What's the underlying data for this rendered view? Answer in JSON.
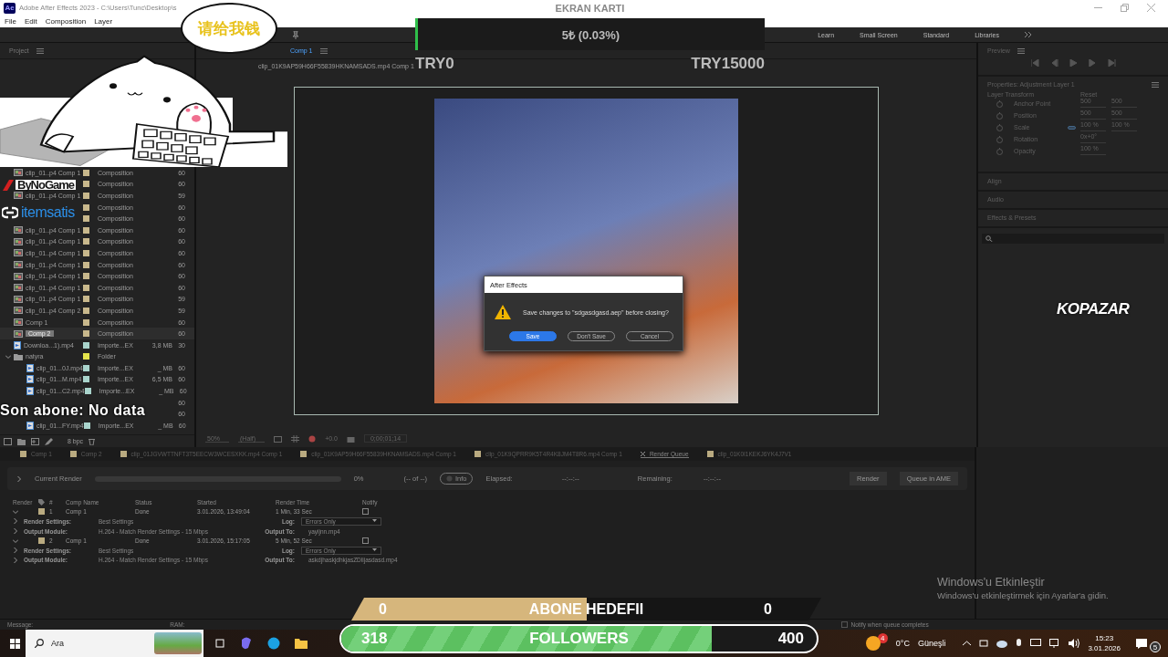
{
  "window": {
    "app_icon": "Ae",
    "title": "Adobe After Effects 2023 - C:\\Users\\Tunc\\Desktop\\s"
  },
  "menu": [
    "File",
    "Edit",
    "Composition",
    "Layer"
  ],
  "workspaces": [
    {
      "label": "Learn",
      "selected": false
    },
    {
      "label": "Small Screen",
      "selected": false
    },
    {
      "label": "Standard",
      "selected": false
    },
    {
      "label": "Libraries",
      "selected": false
    }
  ],
  "project": {
    "tab": "Project",
    "bit_depth": "8 bpc",
    "items": [
      {
        "kind": "comp",
        "name": "clip_01..p4 Comp 1",
        "type": "Composition",
        "fps": "60",
        "color": "#c8b88c",
        "selected": false
      },
      {
        "type": "Composition",
        "fps": "60",
        "color": "#c8b88c"
      },
      {
        "kind": "comp",
        "name": "clip_01..p4 Comp 1",
        "type": "Composition",
        "fps": "59",
        "color": "#c8b88c",
        "selected": false
      },
      {
        "type": "Composition",
        "fps": "60",
        "color": "#c8b88c"
      },
      {
        "type": "Composition",
        "fps": "60",
        "color": "#c8b88c"
      },
      {
        "kind": "comp",
        "name": "clip_01..p4 Comp 1",
        "type": "Composition",
        "fps": "60",
        "color": "#c8b88c",
        "selected": false
      },
      {
        "kind": "comp",
        "name": "clip_01..p4 Comp 1",
        "type": "Composition",
        "fps": "60",
        "color": "#c8b88c",
        "selected": false
      },
      {
        "kind": "comp",
        "name": "clip_01..p4 Comp 1",
        "type": "Composition",
        "fps": "60",
        "color": "#c8b88c",
        "selected": false
      },
      {
        "kind": "comp",
        "name": "clip_01..p4 Comp 1",
        "type": "Composition",
        "fps": "60",
        "color": "#c8b88c",
        "selected": false
      },
      {
        "kind": "comp",
        "name": "clip_01..p4 Comp 1",
        "type": "Composition",
        "fps": "60",
        "color": "#c8b88c",
        "selected": false
      },
      {
        "kind": "comp",
        "name": "clip_01..p4 Comp 1",
        "type": "Composition",
        "fps": "60",
        "color": "#c8b88c",
        "selected": false
      },
      {
        "kind": "comp",
        "name": "clip_01..p4 Comp 1",
        "type": "Composition",
        "fps": "59",
        "color": "#c8b88c",
        "selected": false
      },
      {
        "kind": "comp",
        "name": "clip_01..p4 Comp 2",
        "type": "Composition",
        "fps": "59",
        "color": "#c8b88c",
        "selected": false
      },
      {
        "kind": "comp",
        "name": "Comp 1",
        "type": "Composition",
        "fps": "60",
        "color": "#c8b88c",
        "selected": false
      },
      {
        "kind": "comp",
        "name": "Comp 2",
        "type": "Composition",
        "fps": "60",
        "color": "#c8b88c",
        "selected": true
      },
      {
        "kind": "footage",
        "name": "Downloa...1).mp4",
        "type": "Importe...EX",
        "size": "3,8 MB",
        "fps": "30",
        "color": "#a9d4cc",
        "selected": false
      },
      {
        "kind": "folder",
        "name": "natyra",
        "type": "Folder",
        "color": "#e4e44c",
        "selected": false,
        "expanded": true,
        "children": [
          {
            "kind": "footage",
            "name": "clip_01...0J.mp4",
            "type": "Importe...EX",
            "size": "_ MB",
            "fps": "60",
            "color": "#a9d4cc",
            "selected": false
          },
          {
            "kind": "footage",
            "name": "clip_01...M.mp4",
            "type": "Importe...EX",
            "size": "6,5 MB",
            "fps": "60",
            "color": "#a9d4cc",
            "selected": false
          },
          {
            "kind": "footage",
            "name": "clip_01...C2.mp4",
            "type": "Importe...EX",
            "size": "_ MB",
            "fps": "60",
            "color": "#a9d4cc",
            "selected": false
          },
          {
            "fps": "60"
          },
          {
            "fps": "60"
          },
          {
            "kind": "footage",
            "name": "clip_01...FY.mp4",
            "type": "Importe...EX",
            "size": "_ MB",
            "fps": "60",
            "color": "#a9d4cc",
            "selected": false
          }
        ]
      }
    ]
  },
  "viewer": {
    "tab": "Comp 1",
    "breadcrumb": "clip_01K9AP59H66F55839HKNAMSADS.mp4 Comp 1",
    "zoom": "50%",
    "resolution": "(Half)",
    "exposure": "+0.0",
    "timecode": "0;00;01;14"
  },
  "dialog": {
    "title": "After Effects",
    "message": "Save changes to \"sdgasdgasd.aep\" before closing?",
    "buttons": [
      {
        "label": "Save",
        "selected": true
      },
      {
        "label": "Don't Save",
        "selected": false
      },
      {
        "label": "Cancel",
        "selected": false
      }
    ]
  },
  "right_panel": {
    "preview": "Preview",
    "properties_title": "Properties: Adjustment Layer 1",
    "group": "Layer Transform",
    "reset": "Reset",
    "properties": [
      {
        "name": "Anchor Point",
        "values": [
          "500",
          "500"
        ],
        "linked": false
      },
      {
        "name": "Position",
        "values": [
          "500",
          "500"
        ],
        "linked": false
      },
      {
        "name": "Scale",
        "values": [
          "100 %",
          "100 %"
        ],
        "linked": true
      },
      {
        "name": "Rotation",
        "values": [
          "0x+0°"
        ],
        "linked": false
      },
      {
        "name": "Opacity",
        "values": [
          "100 %"
        ],
        "linked": false
      }
    ],
    "sections": [
      "Align",
      "Audio",
      "Effects & Presets"
    ]
  },
  "render_queue": {
    "tabs": [
      {
        "label": "Comp 1",
        "selected": false
      },
      {
        "label": "Comp 2",
        "selected": false
      },
      {
        "label": "clip_01JGVWTTNFT3T5EECW3WCESXKK.mp4 Comp 1",
        "selected": false
      },
      {
        "label": "clip_01K9AP59H66F55839HKNAMSADS.mp4 Comp 1",
        "selected": false
      },
      {
        "label": "clip_01K9QPRR9K5T4R4K8JM4T8R6.mp4 Comp 1",
        "selected": false
      },
      {
        "label": "Render Queue",
        "selected": true
      },
      {
        "label": "clip_01K0I1KEKJ6YK4J7V1",
        "selected": false
      }
    ],
    "current_render": "Current Render",
    "progress": {
      "level": 0
    },
    "percent": "0%",
    "count": "(-- of --)",
    "info": "Info",
    "elapsed_label": "Elapsed:",
    "elapsed": "--:--:--",
    "remaining_label": "Remaining:",
    "remaining": "--:--:--",
    "render_button": "Render",
    "ame_button": "Queue in AME",
    "columns": [
      "Render",
      "#",
      "Comp Name",
      "Status",
      "Started",
      "Render Time",
      "Notify"
    ],
    "items": [
      {
        "index": "1",
        "comp": "Comp 1",
        "status": "Done",
        "started": "3.01.2026, 13:49:04",
        "render_time": "1 Min, 33 Sec",
        "notify": false,
        "settings": [
          {
            "label": "Render Settings:",
            "value": "Best Settings",
            "extra_label": "Log:",
            "extra_value": "Errors Only",
            "kind": "dropdown"
          },
          {
            "label": "Output Module:",
            "value": "H.264 - Match Render Settings - 15 Mbps",
            "extra_label": "Output To:",
            "extra_value": "yayijnn.mp4",
            "kind": "path"
          }
        ]
      },
      {
        "index": "2",
        "comp": "Comp 1",
        "status": "Done",
        "started": "3.01.2026, 15:17:05",
        "render_time": "5 Min, 52 Sec",
        "notify": false,
        "settings": [
          {
            "label": "Render Settings:",
            "value": "Best Settings",
            "extra_label": "Log:",
            "extra_value": "Errors Only",
            "kind": "dropdown"
          },
          {
            "label": "Output Module:",
            "value": "H.264 - Match Render Settings - 15 Mbps",
            "extra_label": "Output To:",
            "extra_value": "askdjhaskjdhkjasZDlijasdasd.mp4",
            "kind": "path"
          }
        ]
      }
    ]
  },
  "status_bar": {
    "message": "Message:",
    "ram": "RAM:",
    "notify": "Notify when queue completes",
    "notify_checked": false
  },
  "activation": {
    "title": "Windows'u Etkinleştir",
    "text": "Windows'u etkinleştirmek için Ayarlar'a gidin."
  },
  "taskbar": {
    "search": "Ara",
    "weather_badge": "4",
    "weather": "0°C",
    "weather_text": "Güneşli",
    "time": "15:23",
    "date": "3.01.2026",
    "notifications": "5"
  },
  "overlays": {
    "gpu": {
      "title": "EKRAN KARTI",
      "amount": "5₺ (0.03%)",
      "level": 0.0003,
      "min": "TRY0",
      "max": "TRY15000"
    },
    "sticker": {
      "speech": "请给我钱"
    },
    "sponsors": [
      "ByNoGame",
      "itemsatis"
    ],
    "last_sub": "Son abone: No data",
    "brand": "KOPAZAR",
    "sub_goal": {
      "current": "0",
      "label": "ABONE HEDEFII",
      "target": "0",
      "level": 0.5
    },
    "followers": {
      "current": "318",
      "label": "FOLLOWERS",
      "target": "400",
      "level": 0.78
    }
  }
}
